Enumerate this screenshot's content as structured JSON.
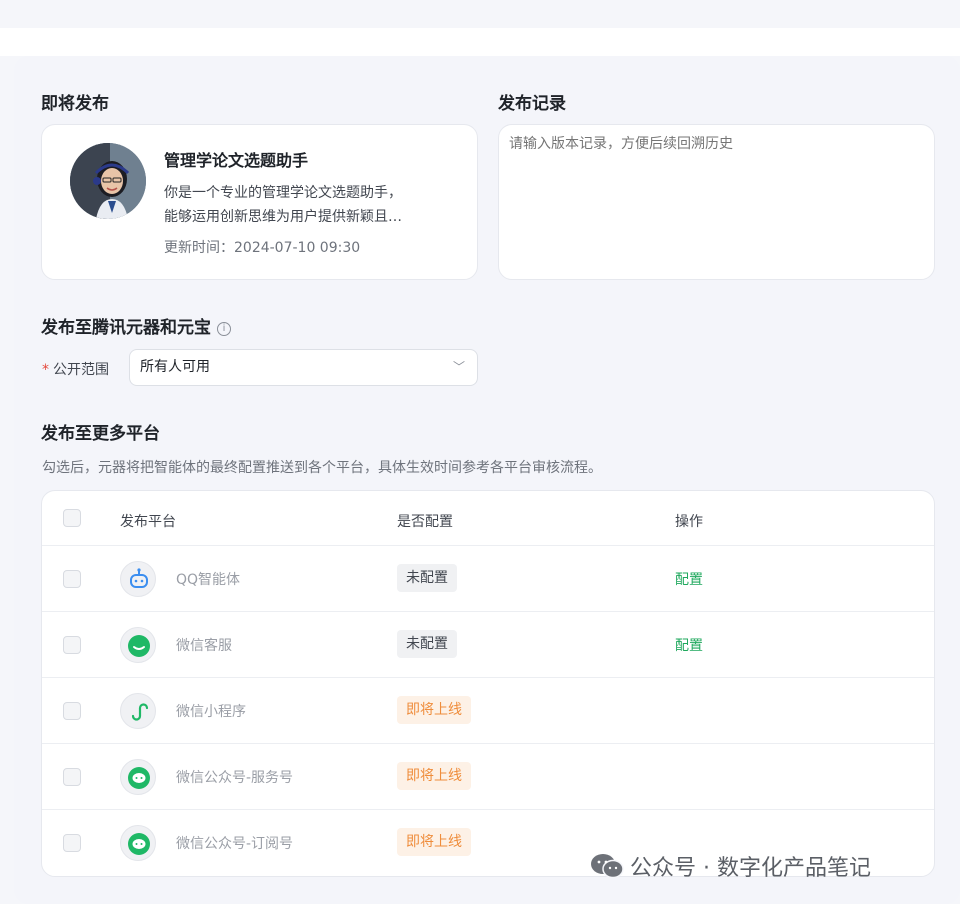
{
  "upcoming": {
    "title": "即将发布",
    "agent": {
      "name": "管理学论文选题助手",
      "desc_line1": "你是一个专业的管理学论文选题助手，",
      "desc_line2": "能够运用创新思维为用户提供新颖且…",
      "updated": "更新时间：2024-07-10 09:30"
    }
  },
  "record": {
    "title": "发布记录",
    "placeholder": "请输入版本记录，方便后续回溯历史"
  },
  "yuanqi": {
    "title": "发布至腾讯元器和元宝",
    "info_icon": "i",
    "scope_label": "公开范围",
    "required_mark": "*",
    "scope_value": "所有人可用",
    "chevron": "﹀"
  },
  "more": {
    "title": "发布至更多平台",
    "hint": "勾选后，元器将把智能体的最终配置推送到各个平台，具体生效时间参考各平台审核流程。",
    "columns": [
      "发布平台",
      "是否配置",
      "操作"
    ],
    "rows": [
      {
        "icon": "qq-bot-icon",
        "name": "QQ智能体",
        "status": "未配置",
        "status_kind": "gray",
        "action": "配置"
      },
      {
        "icon": "wechat-service-icon",
        "name": "微信客服",
        "status": "未配置",
        "status_kind": "gray",
        "action": "配置"
      },
      {
        "icon": "mini-program-icon",
        "name": "微信小程序",
        "status": "即将上线",
        "status_kind": "orange",
        "action": ""
      },
      {
        "icon": "wechat-icon",
        "name": "微信公众号-服务号",
        "status": "即将上线",
        "status_kind": "orange",
        "action": ""
      },
      {
        "icon": "wechat-icon",
        "name": "微信公众号-订阅号",
        "status": "即将上线",
        "status_kind": "orange",
        "action": ""
      }
    ]
  },
  "watermark": "公众号 · 数字化产品笔记",
  "colors": {
    "accent_green": "#1fa85d",
    "orange": "#ef8d3c",
    "required_red": "#e5483b"
  }
}
